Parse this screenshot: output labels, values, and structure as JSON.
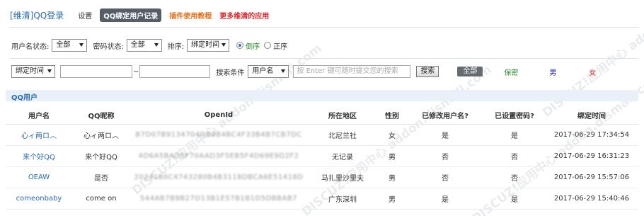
{
  "header": {
    "title": "[维清]QQ登录",
    "nav": [
      {
        "label": "设置",
        "style": "plain"
      },
      {
        "label": "QQ绑定用户记录",
        "style": "active"
      },
      {
        "label": "插件使用教程",
        "style": "orange"
      },
      {
        "label": "更多维清的应用",
        "style": "red"
      }
    ]
  },
  "filters": {
    "username_status_label": "用户名状态:",
    "username_status_value": "全部",
    "password_status_label": "密码状态:",
    "password_status_value": "全部",
    "sort_label": "排序:",
    "sort_value": "绑定时间",
    "order_desc_label": "倒序",
    "order_asc_label": "正序",
    "order_selected": "desc",
    "time_field_value": "绑定时间",
    "date_from_value": "",
    "range_sep": "~",
    "date_to_value": "",
    "search_condition_label": "搜索条件",
    "search_field_value": "用户名",
    "search_placeholder": "按 Enter 键可随时提交您的搜索",
    "search_button_label": "搜索",
    "quick_all": "全部",
    "quick_secret": "保密",
    "quick_male": "男",
    "quick_female": "女"
  },
  "section": {
    "title": "QQ用户"
  },
  "table": {
    "columns": [
      "用户名",
      "QQ昵称",
      "OpenId",
      "所在地区",
      "性别",
      "已修改用户名?",
      "已设置密码?",
      "绑定时间"
    ],
    "rows": [
      {
        "username": "心ィ两ロ︿",
        "nickname": "心ィ两ロ︿",
        "openid": "B7D07B9134704DB8B4BC4F33B4B7CB7DC",
        "region": "北尼兰社",
        "gender": "女",
        "gender_type": "female",
        "changed_username": "是",
        "set_password": "是",
        "bind_time": "2017-06-29 17:34:54"
      },
      {
        "username": "来个好QQ",
        "nickname": "来个好QQ",
        "openid": "4D6A5BAD5F70AAD3F5EB5F4D69E9D2F2",
        "region": "无记录",
        "gender": "男",
        "gender_type": "male",
        "changed_username": "否",
        "set_password": "否",
        "bind_time": "2017-06-29 16:31:23"
      },
      {
        "username": "OEAW",
        "nickname": "是否",
        "openid": "2024180C4743280B4B3118DBCA6E51418D",
        "region": "马扎里沙里夫",
        "gender": "男",
        "gender_type": "male",
        "changed_username": "否",
        "set_password": "否",
        "bind_time": "2017-06-29 15:57:06"
      },
      {
        "username": "comeonbaby",
        "nickname": "come on",
        "openid": "544AB7B9B27D13B1E57B1B1D5DBBAB7",
        "region": "广东深圳",
        "gender": "男",
        "gender_type": "male",
        "changed_username": "是",
        "set_password": "是",
        "bind_time": "2017-06-29 15:40:46"
      }
    ]
  },
  "watermark": {
    "text": "DISCUZ!应用中心 addon.dismall.com"
  },
  "colors": {
    "accent": "#2a6bb3",
    "orange": "#e8711b",
    "red": "#e0262a",
    "male": "#1a1acc",
    "secret": "#2e8b2e"
  }
}
